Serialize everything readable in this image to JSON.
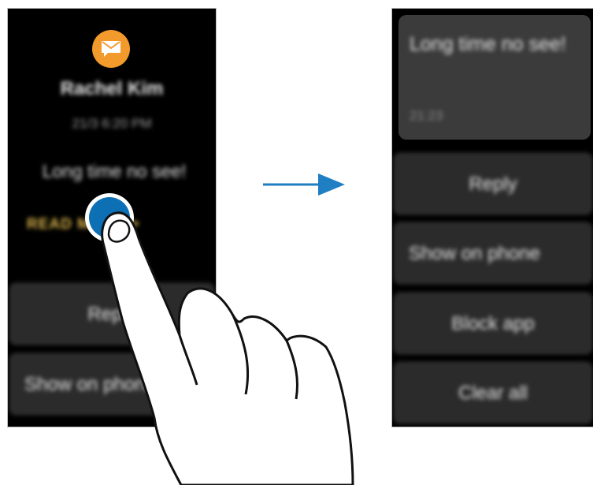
{
  "left_screen": {
    "sender": "Rachel Kim",
    "timestamp": "21/3 6:20 PM",
    "message": "Long time no see!",
    "read_more": "READ MORE >",
    "buttons": [
      "Reply",
      "Show on phone"
    ]
  },
  "right_screen": {
    "bubble_message": "Long time no see!",
    "bubble_time": "21:23",
    "buttons": [
      "Reply",
      "Show on phone",
      "Block app",
      "Clear all"
    ]
  },
  "colors": {
    "accent": "#1f7fc2",
    "mail_icon": "#f39a2c",
    "read_more": "#d9b34a"
  }
}
